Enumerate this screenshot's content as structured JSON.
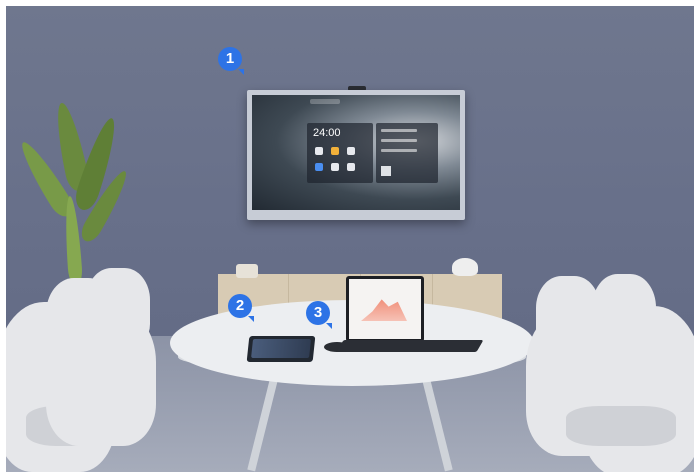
{
  "markers": [
    {
      "label": "1"
    },
    {
      "label": "2"
    },
    {
      "label": "3"
    }
  ],
  "wall_display": {
    "clock_text": "24:00"
  }
}
